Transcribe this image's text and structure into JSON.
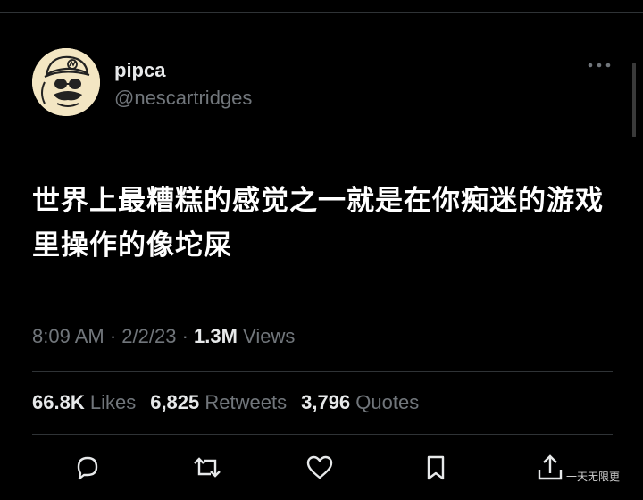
{
  "author": {
    "name": "pipca",
    "handle": "@nescartridges",
    "avatar_icon": "cartoon-cap-avatar-icon"
  },
  "tweet": {
    "text": "世界上最糟糕的感觉之一就是在你痴迷的游戏里操作的像坨屎"
  },
  "meta": {
    "time": "8:09 AM",
    "sep1": " · ",
    "date": "2/2/23",
    "sep2": " · ",
    "views_count": "1.3M",
    "views_label": " Views"
  },
  "stats": {
    "likes_count": "66.8K",
    "likes_label": "Likes",
    "retweets_count": "6,825",
    "retweets_label": "Retweets",
    "quotes_count": "3,796",
    "quotes_label": "Quotes"
  },
  "actions": [
    "reply-icon",
    "retweet-icon",
    "like-icon",
    "bookmark-icon",
    "share-icon"
  ],
  "watermark": "一天无限更",
  "colors": {
    "background": "#000000",
    "primary_text": "#e7e9ea",
    "secondary_text": "#71767b",
    "divider": "#2f3336"
  }
}
